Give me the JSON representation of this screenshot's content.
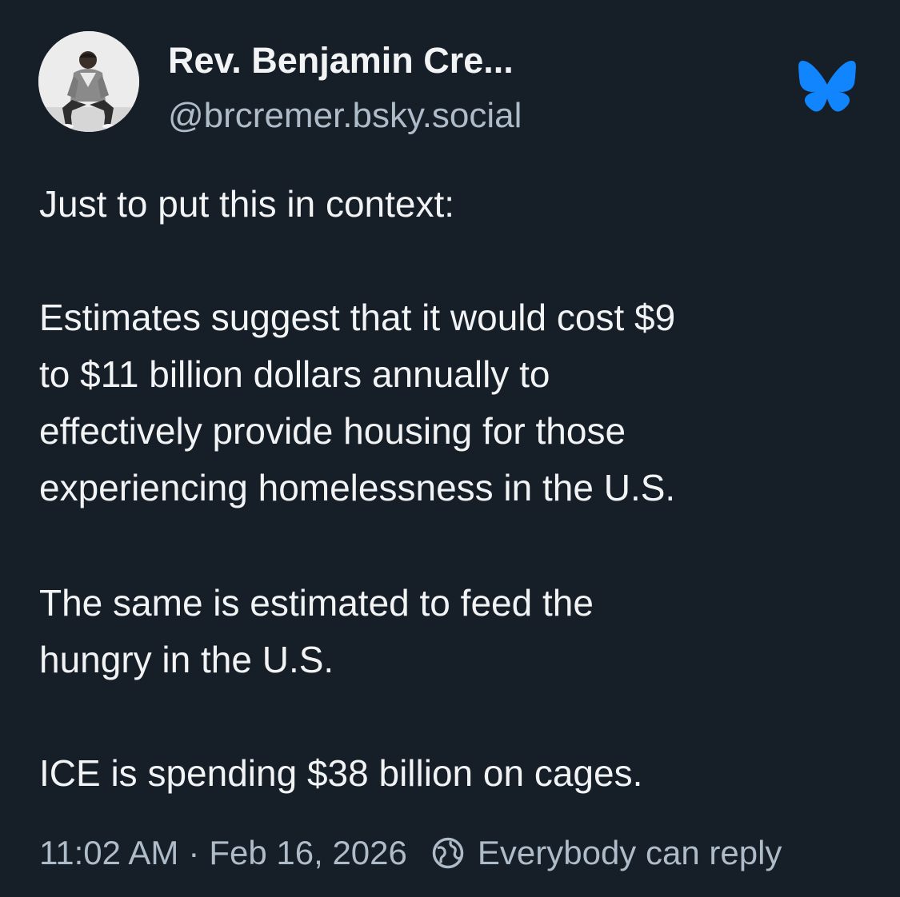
{
  "author": {
    "display_name": "Rev. Benjamin Cre...",
    "handle": "@brcremer.bsky.social",
    "avatar_icon": "person-sitting-photo"
  },
  "brand": {
    "logo_icon": "bluesky-butterfly-icon",
    "accent_color": "#1185fe"
  },
  "post": {
    "lines": [
      "Just to put this in context:",
      "Estimates suggest that it would cost $9",
      "to $11 billion dollars annually to",
      "effectively provide housing for those",
      "experiencing homelessness in the U.S.",
      "The same is estimated to feed the",
      "hungry in the U.S.",
      "ICE is spending $38 billion on cages."
    ]
  },
  "footer": {
    "time": "11:02 AM",
    "separator": "·",
    "date": "Feb 16, 2026",
    "reply_setting": "Everybody can reply",
    "reply_icon": "globe-icon"
  },
  "colors": {
    "background": "#161e27",
    "text": "#f1f3f5",
    "muted": "#aebbc9"
  }
}
